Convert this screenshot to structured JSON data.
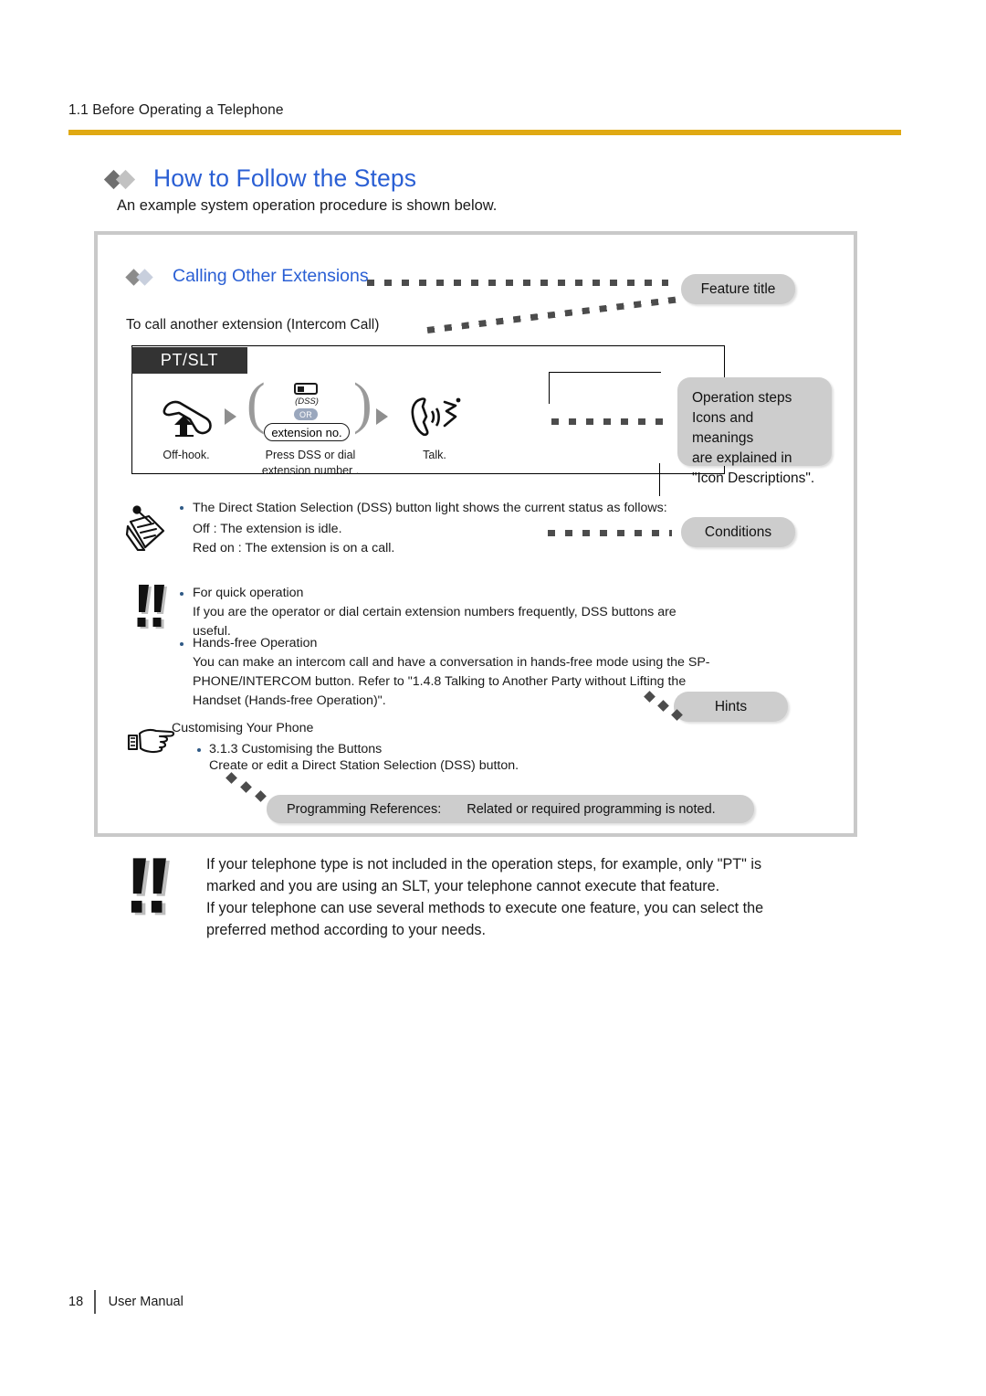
{
  "header": {
    "running_head": "1.1 Before Operating a Telephone",
    "rule_color": "#e0a913"
  },
  "section": {
    "title": "How to Follow the Steps",
    "title_color": "#2a5fd4",
    "intro": "An example system operation procedure is shown below."
  },
  "example": {
    "feature_heading": "Calling Other Extensions",
    "feature_subtitle": "To call another extension (Intercom Call)",
    "steps_panel": {
      "type_label": "PT/SLT",
      "steps": [
        {
          "icon": "offhook-handset-icon",
          "label": "Off-hook."
        },
        {
          "icon": "dss-button-icon",
          "caption": "(DSS)",
          "or_label": "OR",
          "dial_box": "extension no.",
          "label_line1": "Press DSS or dial",
          "label_line2": "extension number  ."
        },
        {
          "icon": "talking-handset-icon",
          "label": "Talk."
        }
      ]
    },
    "callouts": {
      "feature_title": "Feature title",
      "operation_steps": "Operation steps\nIcons and meanings\nare explained in\n\"Icon Descriptions\".",
      "operation_steps_lines": [
        "Operation steps",
        "Icons and meanings",
        "are explained in",
        "\"Icon Descriptions\"."
      ],
      "conditions": "Conditions",
      "hints": "Hints"
    },
    "conditions_block": {
      "icon": "notepad-pencil-icon",
      "bullets": [
        {
          "title": "The Direct Station Selection (DSS) button light shows the current status as follows:",
          "lines": [
            "Off : The extension is idle.",
            "Red on : The extension is on a call."
          ]
        }
      ]
    },
    "hints_block": {
      "icon": "double-exclamation-icon",
      "bullets": [
        {
          "title": "For quick operation",
          "lines": [
            "If you are the operator or dial certain extension numbers frequently, DSS buttons are",
            "useful."
          ]
        },
        {
          "title": "Hands-free Operation",
          "lines": [
            "You can make an intercom call and have a conversation in hands-free mode using the SP-",
            "PHONE/INTERCOM button. Refer to \"1.4.8 Talking to Another Party without Lifting the",
            "Handset (Hands-free Operation)\"."
          ]
        }
      ]
    },
    "customising_block": {
      "icon": "pointing-hand-icon",
      "title": "Customising Your Phone",
      "bullets": [
        {
          "title": "3.1.3 Customising the Buttons",
          "lines": [
            "Create or edit a Direct Station Selection (DSS) button."
          ]
        }
      ]
    },
    "programming_references": {
      "label": "Programming References:",
      "value": "Related or required programming is noted."
    }
  },
  "bottom_notice": {
    "icon": "double-exclamation-icon",
    "paragraphs": [
      [
        "If your telephone type is not included in the operation steps, for example, only \"PT\" is",
        "marked and you are using an SLT, your telephone cannot execute that feature."
      ],
      [
        "If your telephone can use several methods to execute one feature, you can select the",
        "preferred method according to your needs."
      ]
    ]
  },
  "footer": {
    "page_number": "18",
    "manual_label": "User Manual"
  }
}
